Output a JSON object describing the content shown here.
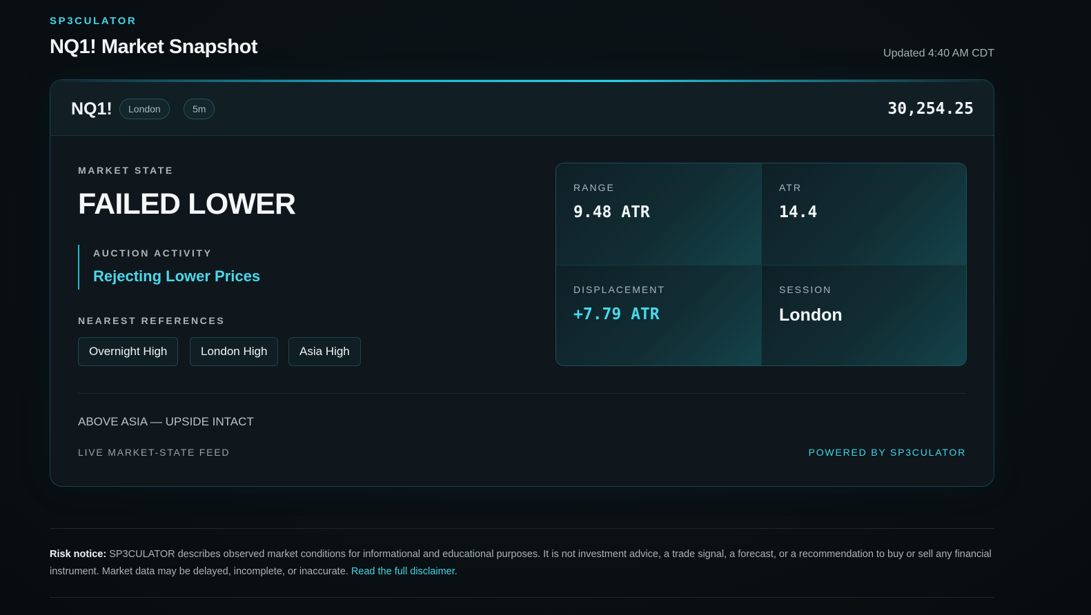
{
  "header": {
    "brand": "SP3CULATOR",
    "title": "NQ1! Market Snapshot",
    "updated": "Updated 4:40 AM CDT"
  },
  "card": {
    "symbol": "NQ1!",
    "session_pill": "London",
    "timeframe_pill": "5m",
    "price": "30,254.25",
    "market_state": {
      "label": "MARKET STATE",
      "value": "FAILED LOWER"
    },
    "auction_activity": {
      "label": "AUCTION ACTIVITY",
      "value": "Rejecting Lower Prices"
    },
    "nearest_references": {
      "label": "NEAREST REFERENCES",
      "items": [
        "Overnight High",
        "London High",
        "Asia High"
      ]
    },
    "metrics": [
      {
        "label": "RANGE",
        "value": "9.48 ATR"
      },
      {
        "label": "ATR",
        "value": "14.4"
      },
      {
        "label": "DISPLACEMENT",
        "value": "+7.79 ATR"
      },
      {
        "label": "SESSION",
        "value": "London"
      }
    ],
    "summary": "ABOVE ASIA — UPSIDE INTACT",
    "feed_label": "LIVE MARKET-STATE FEED",
    "powered_by": "POWERED BY SP3CULATOR"
  },
  "risk": {
    "heading": "Risk notice:",
    "text": " SP3CULATOR describes observed market conditions for informational and educational purposes. It is not investment advice, a trade signal, a forecast, or a recommendation to buy or sell any financial instrument. Market data may be delayed, incomplete, or inaccurate. ",
    "link": "Read the full disclaimer."
  },
  "colors": {
    "accent": "#3fd6e6",
    "background": "#0a1014",
    "card": "#0f171c"
  }
}
